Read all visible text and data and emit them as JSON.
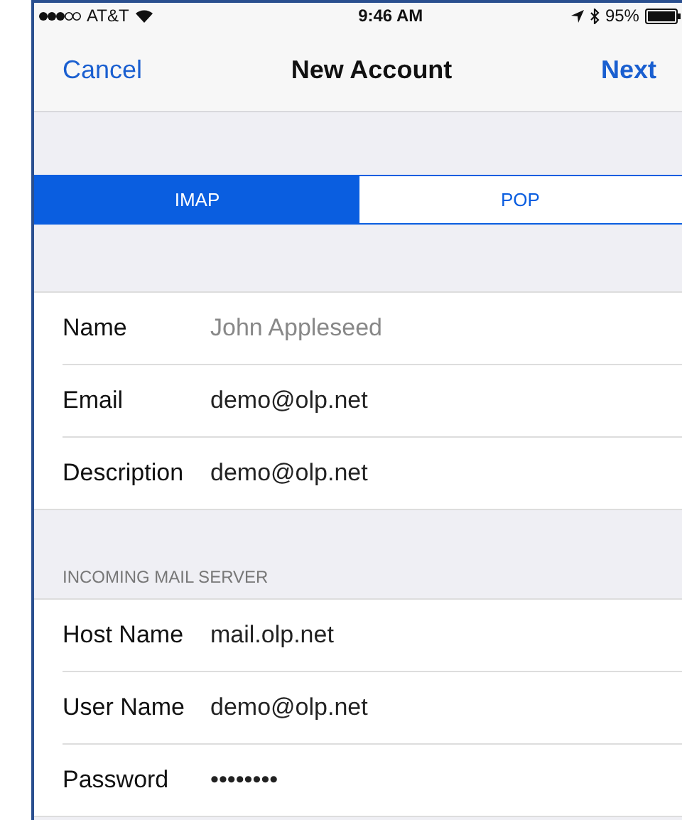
{
  "status_bar": {
    "carrier": "AT&T",
    "time": "9:46 AM",
    "battery": "95%"
  },
  "nav": {
    "cancel": "Cancel",
    "title": "New Account",
    "next": "Next"
  },
  "segments": [
    {
      "label": "IMAP",
      "selected": true
    },
    {
      "label": "POP",
      "selected": false
    }
  ],
  "sections": [
    {
      "rows": [
        {
          "label": "Name",
          "placeholder": "John Appleseed"
        },
        {
          "label": "Email",
          "value": "demo@olp.net"
        },
        {
          "label": "Description",
          "value": "demo@olp.net"
        }
      ]
    },
    {
      "header": "INCOMING MAIL SERVER",
      "rows": [
        {
          "label": "Host Name",
          "value": "mail.olp.net"
        },
        {
          "label": "User Name",
          "value": "demo@olp.net"
        },
        {
          "label": "Password",
          "value": "••••••••"
        }
      ]
    }
  ]
}
